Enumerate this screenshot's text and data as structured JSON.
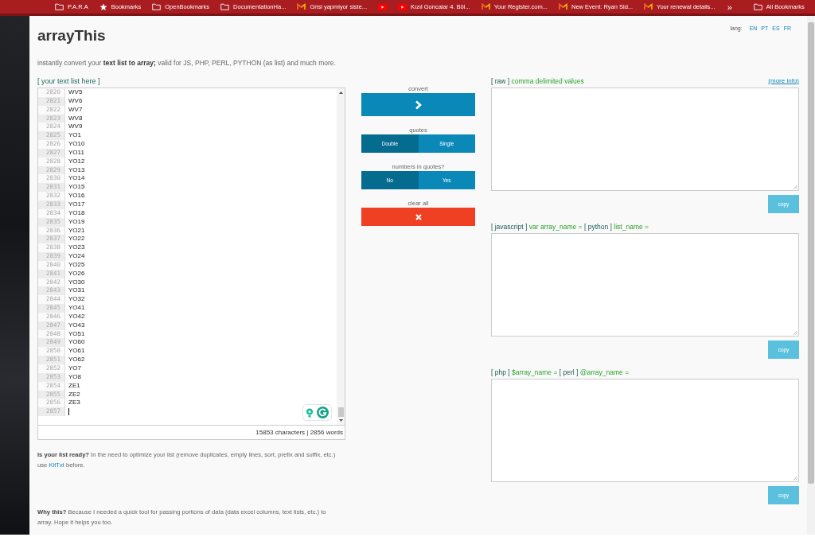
{
  "bookmarks_bar": {
    "items": [
      {
        "kind": "folder",
        "label": "P.A.R.A"
      },
      {
        "kind": "star",
        "label": "Bookmarks"
      },
      {
        "kind": "folder",
        "label": "OpenBookmarks"
      },
      {
        "kind": "folder",
        "label": "DocumentationHa..."
      },
      {
        "kind": "mail",
        "label": "Grisi yapmiyor siste..."
      },
      {
        "kind": "video"
      },
      {
        "kind": "video",
        "label": "Kızıl Goncalar 4. Böl..."
      },
      {
        "kind": "mail",
        "label": "Your Register.com..."
      },
      {
        "kind": "mail",
        "label": "New Event: Ryan Sid..."
      },
      {
        "kind": "mail",
        "label": "Your renewal details..."
      }
    ],
    "overflow": "»",
    "end_item": {
      "kind": "folder",
      "label": "All Bookmarks"
    }
  },
  "header": {
    "title": "arrayThis",
    "lang_label": "lang:",
    "languages": [
      "EN",
      "PT",
      "ES",
      "FR"
    ],
    "tagline": "instantly convert your **text list to array;** valid for JS, PHP, PERL, PYTHON (as list) and much more."
  },
  "input": {
    "label": "[ your text list here ]",
    "lines": [
      {
        "n": "2820",
        "text": "WV5"
      },
      {
        "n": "2821",
        "text": "WV6"
      },
      {
        "n": "2822",
        "text": "WV7"
      },
      {
        "n": "2823",
        "text": "WV8"
      },
      {
        "n": "2824",
        "text": "WV9"
      },
      {
        "n": "2825",
        "text": "YO1"
      },
      {
        "n": "2826",
        "text": "YO10"
      },
      {
        "n": "2827",
        "text": "YO11"
      },
      {
        "n": "2828",
        "text": "YO12"
      },
      {
        "n": "2829",
        "text": "YO13"
      },
      {
        "n": "2830",
        "text": "YO14"
      },
      {
        "n": "2831",
        "text": "YO15"
      },
      {
        "n": "2832",
        "text": "YO16"
      },
      {
        "n": "2833",
        "text": "YO17"
      },
      {
        "n": "2834",
        "text": "YO18"
      },
      {
        "n": "2835",
        "text": "YO19"
      },
      {
        "n": "2836",
        "text": "YO21"
      },
      {
        "n": "2837",
        "text": "YO22"
      },
      {
        "n": "2838",
        "text": "YO23"
      },
      {
        "n": "2839",
        "text": "YO24"
      },
      {
        "n": "2840",
        "text": "YO25"
      },
      {
        "n": "2841",
        "text": "YO26"
      },
      {
        "n": "2842",
        "text": "YO30"
      },
      {
        "n": "2843",
        "text": "YO31"
      },
      {
        "n": "2844",
        "text": "YO32"
      },
      {
        "n": "2845",
        "text": "YO41"
      },
      {
        "n": "2846",
        "text": "YO42"
      },
      {
        "n": "2847",
        "text": "YO43"
      },
      {
        "n": "2848",
        "text": "YO51"
      },
      {
        "n": "2849",
        "text": "YO60"
      },
      {
        "n": "2850",
        "text": "YO61"
      },
      {
        "n": "2851",
        "text": "YO62"
      },
      {
        "n": "2852",
        "text": "YO7"
      },
      {
        "n": "2853",
        "text": "YO8"
      },
      {
        "n": "2854",
        "text": "ZE1"
      },
      {
        "n": "2855",
        "text": "ZE2"
      },
      {
        "n": "2856",
        "text": "ZE3"
      },
      {
        "n": "2857",
        "cursor": true
      }
    ],
    "counts": "15853 characters | 2856 words"
  },
  "controls": {
    "convert_label": "convert",
    "quotes_label": "quotes",
    "quotes": [
      {
        "label": "Double",
        "selected": true
      },
      {
        "label": "Single",
        "selected": false
      }
    ],
    "numbers_label": "numbers in quotes?",
    "numbers": [
      {
        "label": "No",
        "selected": true
      },
      {
        "label": "Yes",
        "selected": false
      }
    ],
    "clear_label": "clear all"
  },
  "outputs": [
    {
      "label": [
        {
          "kind": "tag",
          "text": "[ raw ]"
        },
        {
          "kind": "desc",
          "text": "comma delimited values"
        }
      ],
      "link": "(more info)",
      "button": "copy"
    },
    {
      "label": [
        {
          "kind": "tag",
          "text": "[ javascript ]"
        },
        {
          "kind": "desc",
          "text": "var array_name ="
        },
        {
          "kind": "tag",
          "text": "[ python ]"
        },
        {
          "kind": "desc",
          "text": "list_name ="
        }
      ],
      "button": "copy"
    },
    {
      "label": [
        {
          "kind": "tag",
          "text": "[ php ]"
        },
        {
          "kind": "desc",
          "text": "$array_name ="
        },
        {
          "kind": "tag",
          "text": "[ perl ]"
        },
        {
          "kind": "desc",
          "text": "@array_name ="
        }
      ],
      "button": "copy"
    }
  ],
  "notes": [
    {
      "text": "**Is your list ready?** In the need to optimize your list (remove duplicates, empty lines, sort, prefix and suffix, etc.) use",
      "link": "KitTxt",
      "after": "before."
    },
    {
      "text": "**Why this?** Because I needed a quick tool for passing portions of data (data excel columns, text lists, etc.) to array. Hope it helps you too."
    }
  ]
}
